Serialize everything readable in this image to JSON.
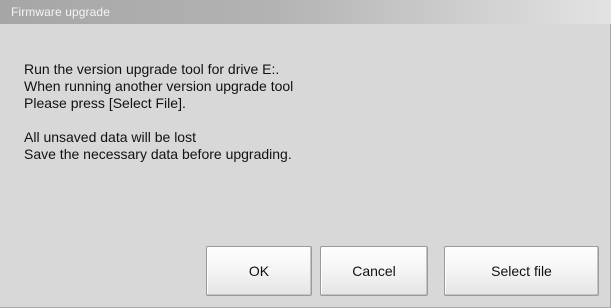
{
  "window": {
    "title": "Firmware upgrade"
  },
  "message": {
    "lines": [
      "Run the version upgrade tool for drive E:.",
      "When running another version upgrade tool",
      "Please press [Select File]."
    ],
    "warning_lines": [
      "All unsaved data will be lost",
      "Save the necessary data before upgrading."
    ]
  },
  "buttons": {
    "ok_label": "OK",
    "cancel_label": "Cancel",
    "select_file_label": "Select file"
  }
}
